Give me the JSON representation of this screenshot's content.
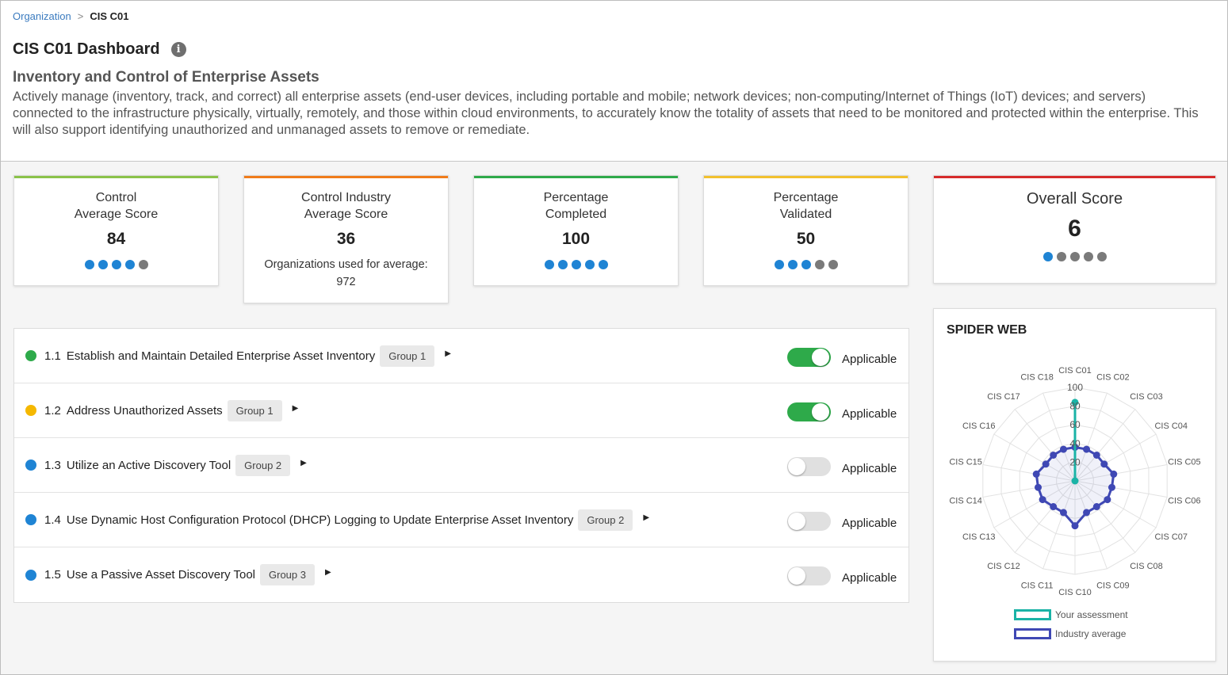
{
  "breadcrumb": {
    "parent": "Organization",
    "separator": ">",
    "current": "CIS C01"
  },
  "page": {
    "title": "CIS C01 Dashboard",
    "info_icon": "info-icon",
    "section_title": "Inventory and Control of Enterprise Assets",
    "section_description": "Actively manage (inventory, track, and correct) all enterprise assets (end-user devices, including portable and mobile; network devices; non-computing/Internet of Things (IoT) devices; and servers) connected to the infrastructure physically, virtually, remotely, and those within cloud environments, to accurately know the totality of assets that need to be monitored and protected within the enterprise. This will also support identifying unauthorized and unmanaged assets to remove or remediate."
  },
  "cards": [
    {
      "label_line1": "Control",
      "label_line2": "Average Score",
      "value": "84",
      "accent": "#8bc34a",
      "dots_on": 4,
      "dots_total": 5
    },
    {
      "label_line1": "Control Industry",
      "label_line2": "Average Score",
      "value": "36",
      "note_line1": "Organizations used for average:",
      "note_line2": "972",
      "accent": "#f07c1b"
    },
    {
      "label_line1": "Percentage",
      "label_line2": "Completed",
      "value": "100",
      "accent": "#2eaa4a",
      "dots_on": 5,
      "dots_total": 5
    },
    {
      "label_line1": "Percentage",
      "label_line2": "Validated",
      "value": "50",
      "accent": "#f2c12e",
      "dots_on": 3,
      "dots_total": 5
    }
  ],
  "overall": {
    "label": "Overall Score",
    "value": "6",
    "accent": "#d62b2b",
    "dots_on": 1,
    "dots_total": 5
  },
  "controls": [
    {
      "id": "1.1",
      "title": "Establish and Maintain Detailed Enterprise Asset Inventory",
      "group": "Group 1",
      "status_color": "#2eaa4a",
      "applicable": true,
      "applicable_label": "Applicable",
      "arrow": "▶"
    },
    {
      "id": "1.2",
      "title": "Address Unauthorized Assets",
      "group": "Group 1",
      "status_color": "#f5b800",
      "applicable": true,
      "applicable_label": "Applicable",
      "arrow": "▶"
    },
    {
      "id": "1.3",
      "title": "Utilize an Active Discovery Tool",
      "group": "Group 2",
      "status_color": "#1f84d4",
      "applicable": false,
      "applicable_label": "Applicable",
      "arrow": "▶"
    },
    {
      "id": "1.4",
      "title": "Use Dynamic Host Configuration Protocol (DHCP) Logging to Update Enterprise Asset Inventory",
      "group": "Group 2",
      "status_color": "#1f84d4",
      "applicable": false,
      "applicable_label": "Applicable",
      "arrow": "▶"
    },
    {
      "id": "1.5",
      "title": "Use a Passive Asset Discovery Tool",
      "group": "Group 3",
      "status_color": "#1f84d4",
      "applicable": false,
      "applicable_label": "Applicable",
      "arrow": "▶"
    }
  ],
  "spider": {
    "title": "SPIDER WEB",
    "legend": [
      {
        "label": "Your assessment",
        "color": "#1ab3a6"
      },
      {
        "label": "Industry average",
        "color": "#3f48b4"
      }
    ]
  },
  "chart_data": {
    "type": "radar",
    "categories": [
      "CIS C01",
      "CIS C02",
      "CIS C03",
      "CIS C04",
      "CIS C05",
      "CIS C06",
      "CIS C07",
      "CIS C08",
      "CIS C09",
      "CIS C10",
      "CIS C11",
      "CIS C12",
      "CIS C13",
      "CIS C14",
      "CIS C15",
      "CIS C16",
      "CIS C17",
      "CIS C18"
    ],
    "rlim": [
      0,
      100
    ],
    "ticks": [
      "20",
      "40",
      "60",
      "80",
      "100"
    ],
    "series": [
      {
        "name": "Your assessment",
        "color": "#1ab3a6",
        "values": [
          84,
          0,
          0,
          0,
          0,
          0,
          0,
          0,
          0,
          0,
          0,
          0,
          0,
          0,
          0,
          0,
          0,
          0
        ]
      },
      {
        "name": "Industry average",
        "color": "#3f48b4",
        "values": [
          36,
          36,
          36,
          36,
          42,
          40,
          40,
          36,
          36,
          48,
          36,
          36,
          40,
          40,
          42,
          36,
          36,
          36
        ]
      }
    ],
    "legend": "bottom",
    "grid": true
  }
}
